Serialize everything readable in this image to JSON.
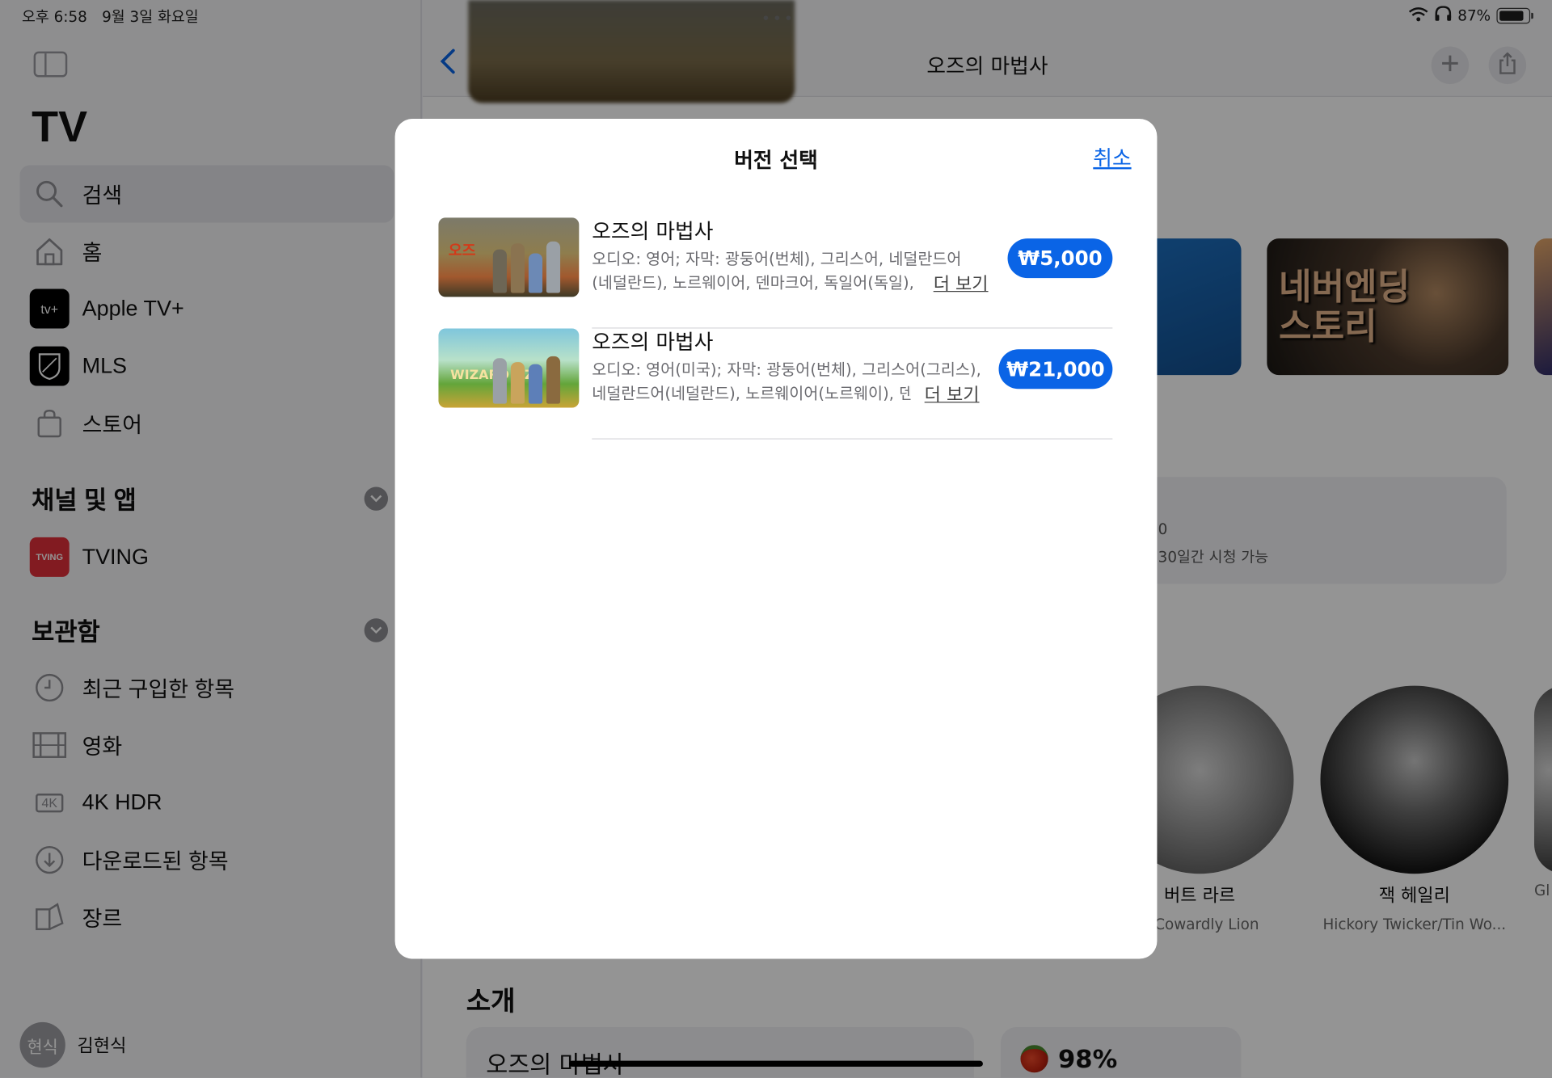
{
  "status_bar": {
    "time": "오후 6:58",
    "date": "9월 3일 화요일",
    "multitask_dots": "•••",
    "battery_text": "87%",
    "battery_level": 0.87
  },
  "sidebar": {
    "title": "TV",
    "nav": [
      {
        "label": "검색",
        "icon": "search-icon",
        "active": true
      },
      {
        "label": "홈",
        "icon": "house-icon"
      },
      {
        "label": "Apple TV+",
        "icon": "appletv-plus-icon",
        "icon_text": "tv+"
      },
      {
        "label": "MLS",
        "icon": "mls-icon",
        "icon_text": "MLS"
      },
      {
        "label": "스토어",
        "icon": "bag-icon"
      }
    ],
    "channels_section": {
      "title": "채널 및 앱"
    },
    "channels": [
      {
        "label": "TVING",
        "icon_text": "TVING"
      }
    ],
    "library_section": {
      "title": "보관함"
    },
    "library": [
      {
        "label": "최근 구입한 항목",
        "icon": "clock-icon"
      },
      {
        "label": "영화",
        "icon": "film-icon"
      },
      {
        "label": "4K HDR",
        "icon": "4k-icon",
        "icon_text": "4K"
      },
      {
        "label": "다운로드된 항목",
        "icon": "download-icon"
      },
      {
        "label": "장르",
        "icon": "genre-icon"
      }
    ],
    "profile": {
      "avatar_text": "현식",
      "name": "김현식"
    }
  },
  "main": {
    "title": "오즈의 마법사",
    "poster_text": "네버엔딩\n스토리",
    "info_line1": "0",
    "info_line2": "30일간 시청 가능",
    "cast": [
      {
        "name": "버트 라르",
        "role": "e/Cowardly Lion"
      },
      {
        "name": "잭 헤일리",
        "role": "Hickory Twicker/Tin Wo..."
      },
      {
        "name": "",
        "role": "Gl"
      }
    ],
    "about_title": "소개",
    "about_card_title": "오즈의 마법사",
    "score": "98%"
  },
  "modal": {
    "title": "버전 선택",
    "cancel": "취소",
    "versions": [
      {
        "title": "오즈의 마법사",
        "desc_line1": "오디오: 영어; 자막: 광둥어(번체), 그리스어, 네덜란드어",
        "desc_line2": "(네덜란드), 노르웨이어, 덴마크어, 독일어(독일),",
        "more": "더 보기",
        "price": "₩5,000",
        "thumb_tag": "오즈"
      },
      {
        "title": "오즈의 마법사",
        "desc_line1": "오디오: 영어(미국); 자막: 광둥어(번체), 그리스어(그리스),",
        "desc_line2": "네덜란드어(네덜란드), 노르웨이어(노르웨이), 덴",
        "more": "더 보기",
        "price": "₩21,000",
        "thumb_tag": "WIZARD OZ"
      }
    ]
  },
  "colors": {
    "accent": "#0a64e6",
    "tving": "#e0303a"
  }
}
